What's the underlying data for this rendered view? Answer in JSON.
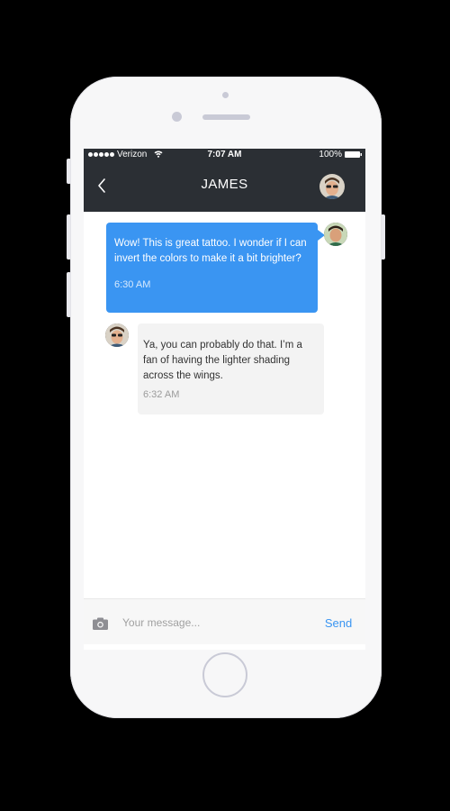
{
  "status_bar": {
    "carrier": "Verizon",
    "time": "7:07 AM",
    "battery": "100%",
    "icons": [
      "signal-icon",
      "wifi-icon",
      "battery-icon"
    ]
  },
  "header": {
    "title": "JAMES",
    "back_icon": "chevron-left-icon",
    "avatar": "contact-avatar"
  },
  "messages": [
    {
      "direction": "outgoing",
      "text": "Wow! This is great tattoo. I wonder if I can invert the colors to make it a bit brighter?",
      "time": "6:30 AM"
    },
    {
      "direction": "incoming",
      "text": "Ya, you can probably do that. I’m a fan of having the lighter shading across the wings.",
      "time": "6:32 AM"
    }
  ],
  "composer": {
    "camera_icon": "camera-icon",
    "placeholder": "Your message...",
    "send_label": "Send"
  },
  "colors": {
    "header_bg": "#2b2f34",
    "outgoing_bubble": "#3a95f2",
    "incoming_bubble": "#f3f3f3",
    "accent": "#3a95f2",
    "phone_body": "#f7f7f8"
  }
}
